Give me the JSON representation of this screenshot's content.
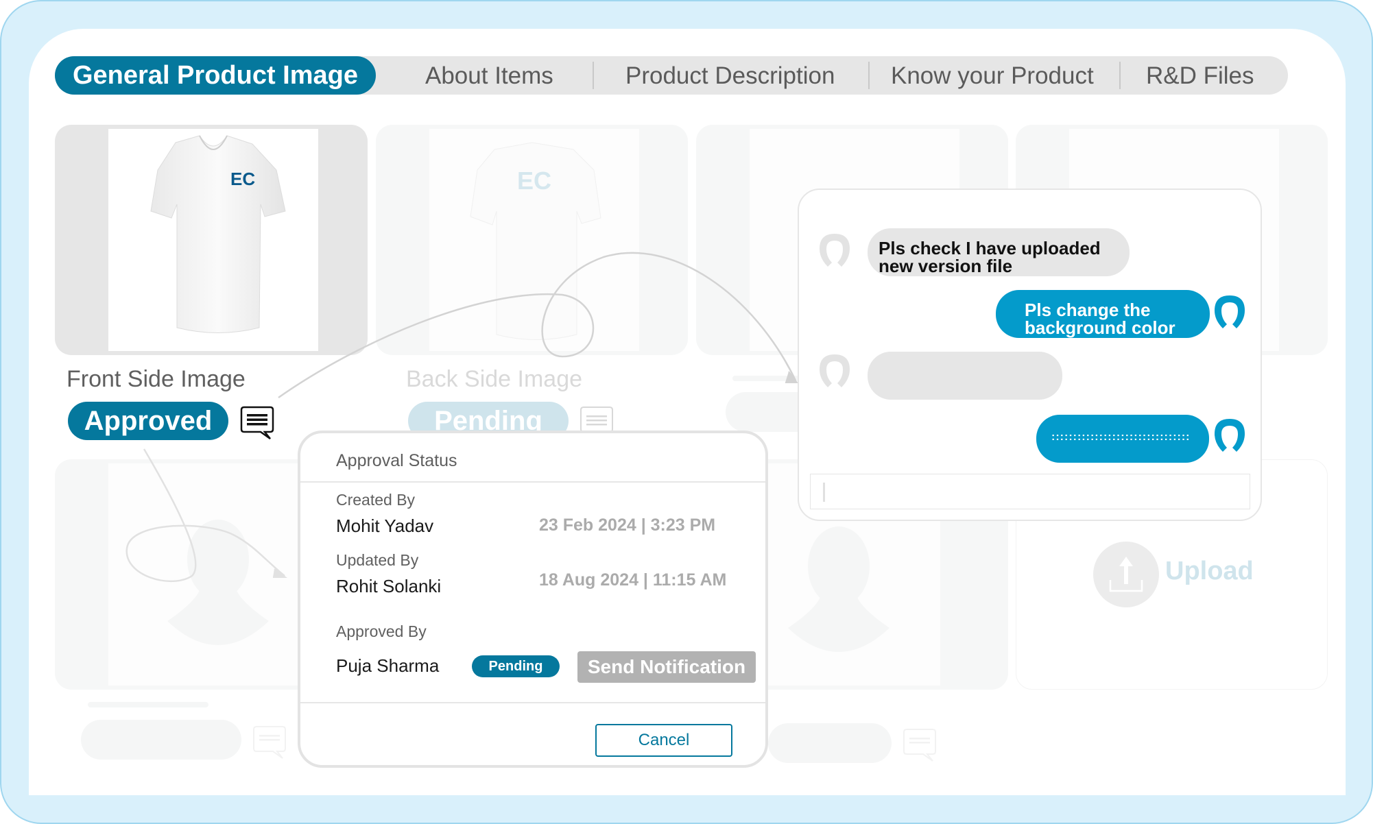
{
  "tabs": [
    {
      "label": "General Product Image",
      "active": true
    },
    {
      "label": "About Items",
      "active": false
    },
    {
      "label": "Product Description",
      "active": false
    },
    {
      "label": "Know your Product",
      "active": false
    },
    {
      "label": "R&D Files",
      "active": false
    }
  ],
  "images": [
    {
      "label": "Front Side Image",
      "status": "Approved",
      "logo": "EC"
    },
    {
      "label": "Back Side Image",
      "status": "Pending",
      "logo": "EC"
    }
  ],
  "approval_dialog": {
    "title": "Approval Status",
    "created_by_label": "Created By",
    "created_by_name": "Mohit Yadav",
    "created_at": "23 Feb 2024 | 3:23 PM",
    "updated_by_label": "Updated By",
    "updated_by_name": "Rohit Solanki",
    "updated_at": "18 Aug 2024 | 11:15 AM",
    "approved_by_label": "Approved By",
    "approved_by_name": "Puja Sharma",
    "approved_status": "Pending",
    "send_notification_label": "Send Notification",
    "cancel_label": "Cancel"
  },
  "chat": {
    "messages": [
      {
        "direction": "in",
        "lines": [
          "Pls check I have uploaded",
          "new version file"
        ]
      },
      {
        "direction": "out",
        "lines": [
          "Pls change the",
          "background color"
        ]
      },
      {
        "direction": "in",
        "lines": []
      },
      {
        "direction": "out",
        "lines": [
          "::::::::::::::::::::::::::::::::"
        ]
      }
    ],
    "input_value": ""
  },
  "upload": {
    "label": "Upload"
  },
  "colors": {
    "primary": "#05789d",
    "chat_out": "#049bcb",
    "chat_in": "#e6e6e6",
    "frame": "#d9f0fb",
    "disabled": "#b2b2b2"
  }
}
